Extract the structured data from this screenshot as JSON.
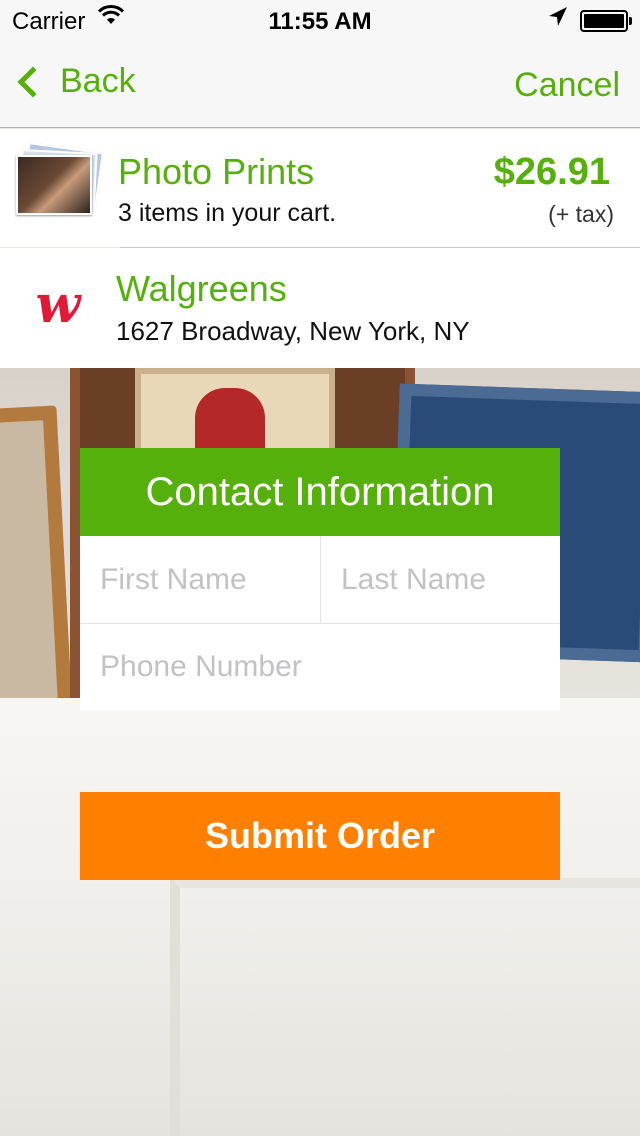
{
  "status_bar": {
    "carrier": "Carrier",
    "time": "11:55 AM"
  },
  "nav": {
    "back_label": "Back",
    "cancel_label": "Cancel"
  },
  "cart": {
    "title": "Photo Prints",
    "summary": "3 items in your cart.",
    "price": "$26.91",
    "tax_note": "(+ tax)"
  },
  "store": {
    "name": "Walgreens",
    "address": "1627 Broadway, New York, NY",
    "logo_text": "w"
  },
  "contact_form": {
    "title": "Contact Information",
    "first_name_placeholder": "First Name",
    "last_name_placeholder": "Last Name",
    "phone_placeholder": "Phone Number"
  },
  "submit_label": "Submit Order",
  "colors": {
    "accent_green": "#56b00b",
    "submit_orange": "#ff7f00",
    "walgreens_red": "#e31837"
  }
}
